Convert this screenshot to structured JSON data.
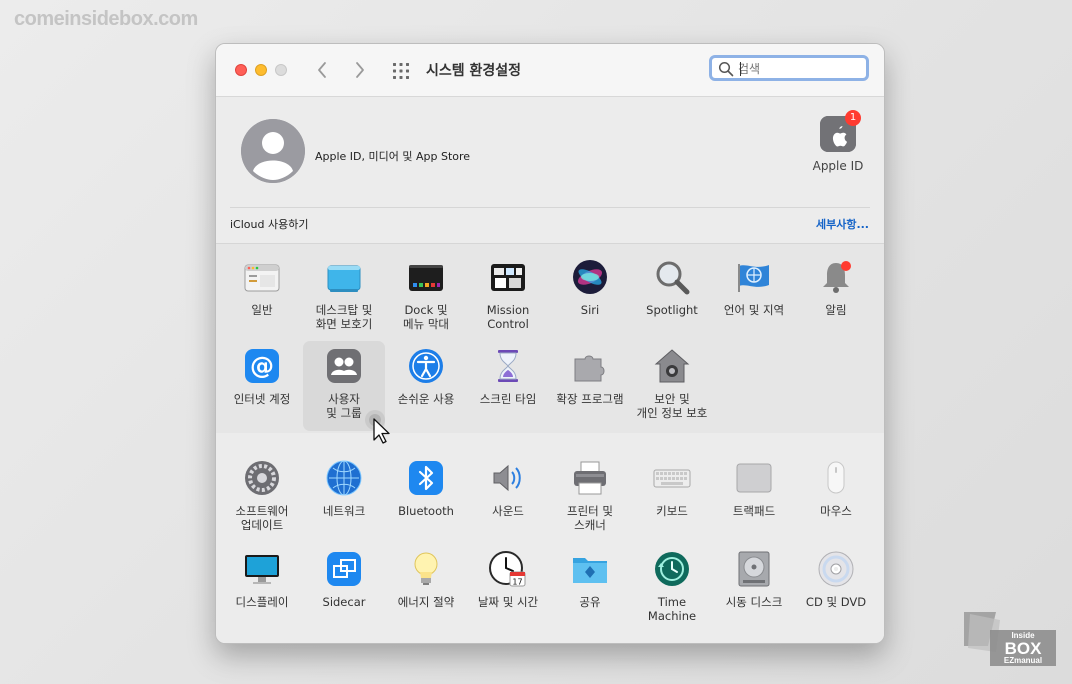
{
  "watermark": "comeinsidebox.com",
  "window": {
    "title": "시스템 환경설정",
    "search_placeholder": "검색"
  },
  "account": {
    "label": "Apple ID, 미디어 및 App Store",
    "apple_id_label": "Apple ID",
    "badge_count": "1"
  },
  "icloud": {
    "label": "iCloud 사용하기",
    "details_link": "세부사항..."
  },
  "panes_row1": [
    {
      "label": "일반",
      "icon": "general-icon"
    },
    {
      "label": "데스크탑 및\n화면 보호기",
      "icon": "desktop-screensaver-icon"
    },
    {
      "label": "Dock 및\n메뉴 막대",
      "icon": "dock-icon"
    },
    {
      "label": "Mission\nControl",
      "icon": "mission-control-icon"
    },
    {
      "label": "Siri",
      "icon": "siri-icon"
    },
    {
      "label": "Spotlight",
      "icon": "spotlight-icon"
    },
    {
      "label": "언어 및 지역",
      "icon": "language-region-icon"
    },
    {
      "label": "알림",
      "icon": "notifications-icon"
    }
  ],
  "panes_row2": [
    {
      "label": "인터넷 계정",
      "icon": "internet-accounts-icon"
    },
    {
      "label": "사용자\n및 그룹",
      "icon": "users-groups-icon",
      "selected": true
    },
    {
      "label": "손쉬운 사용",
      "icon": "accessibility-icon"
    },
    {
      "label": "스크린 타임",
      "icon": "screen-time-icon"
    },
    {
      "label": "확장 프로그램",
      "icon": "extensions-icon"
    },
    {
      "label": "보안 및\n개인 정보 보호",
      "icon": "security-privacy-icon"
    }
  ],
  "panes_row3": [
    {
      "label": "소프트웨어\n업데이트",
      "icon": "software-update-icon"
    },
    {
      "label": "네트워크",
      "icon": "network-icon"
    },
    {
      "label": "Bluetooth",
      "icon": "bluetooth-icon"
    },
    {
      "label": "사운드",
      "icon": "sound-icon"
    },
    {
      "label": "프린터 및\n스캐너",
      "icon": "printer-scanner-icon"
    },
    {
      "label": "키보드",
      "icon": "keyboard-icon"
    },
    {
      "label": "트랙패드",
      "icon": "trackpad-icon"
    },
    {
      "label": "마우스",
      "icon": "mouse-icon"
    }
  ],
  "panes_row4": [
    {
      "label": "디스플레이",
      "icon": "display-icon"
    },
    {
      "label": "Sidecar",
      "icon": "sidecar-icon"
    },
    {
      "label": "에너지 절약",
      "icon": "energy-saver-icon"
    },
    {
      "label": "날짜 및 시간",
      "icon": "date-time-icon"
    },
    {
      "label": "공유",
      "icon": "sharing-icon"
    },
    {
      "label": "Time\nMachine",
      "icon": "time-machine-icon"
    },
    {
      "label": "시동 디스크",
      "icon": "startup-disk-icon"
    },
    {
      "label": "CD 및 DVD",
      "icon": "cd-dvd-icon"
    }
  ],
  "calendar_day": "17",
  "corner_logo": {
    "line1": "Inside",
    "line2": "BOX",
    "line3": "EZmanual"
  }
}
